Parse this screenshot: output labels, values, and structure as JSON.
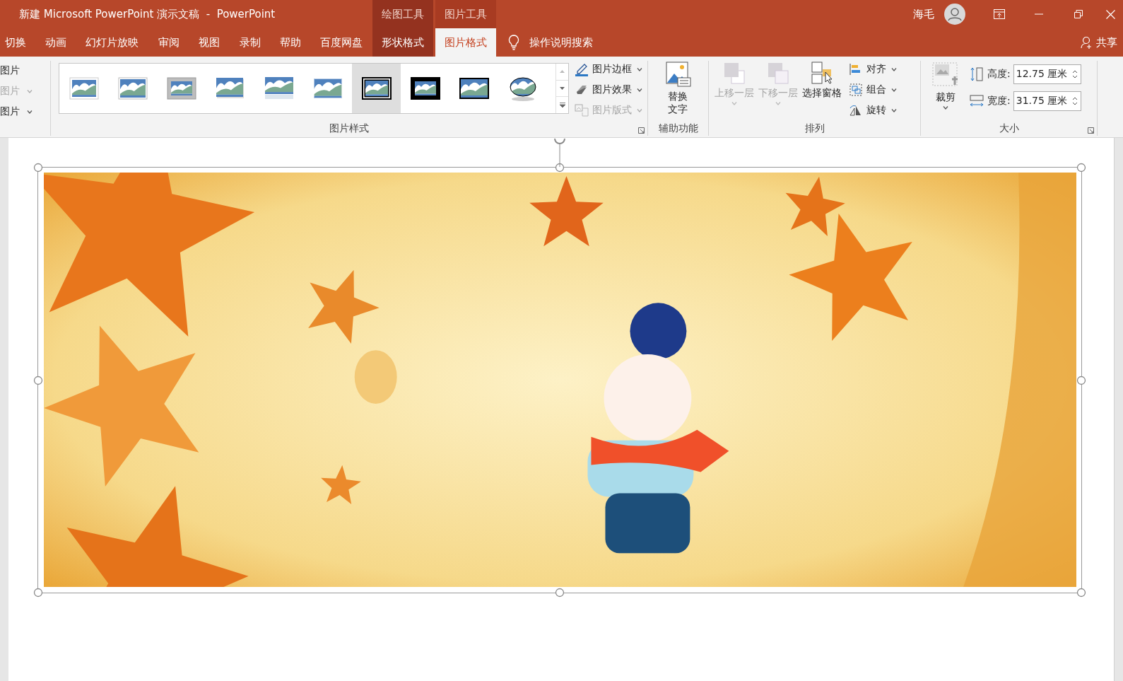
{
  "window": {
    "title": "新建 Microsoft PowerPoint 演示文稿  -  PowerPoint",
    "user": "海毛"
  },
  "context_tools": [
    {
      "label": "绘图工具",
      "active": false
    },
    {
      "label": "图片工具",
      "active": true
    }
  ],
  "tabs": [
    {
      "label": "切换",
      "kind": "main",
      "selected": false
    },
    {
      "label": "动画",
      "kind": "main",
      "selected": false
    },
    {
      "label": "幻灯片放映",
      "kind": "main",
      "selected": false
    },
    {
      "label": "审阅",
      "kind": "main",
      "selected": false
    },
    {
      "label": "视图",
      "kind": "main",
      "selected": false
    },
    {
      "label": "录制",
      "kind": "main",
      "selected": false
    },
    {
      "label": "帮助",
      "kind": "main",
      "selected": false
    },
    {
      "label": "百度网盘",
      "kind": "main",
      "selected": false
    },
    {
      "label": "形状格式",
      "kind": "context",
      "selected": false
    },
    {
      "label": "图片格式",
      "kind": "context",
      "selected": true
    }
  ],
  "tell_me": "操作说明搜索",
  "share": "共享",
  "ribbon": {
    "adjust": [
      {
        "label": "图片",
        "disabled": false,
        "dropdown": false
      },
      {
        "label": "图片",
        "disabled": true,
        "dropdown": true
      },
      {
        "label": "图片",
        "disabled": false,
        "dropdown": true
      }
    ],
    "picture_styles": {
      "title": "图片样式",
      "presets": [
        {
          "selected": false
        },
        {
          "selected": false
        },
        {
          "selected": false
        },
        {
          "selected": false
        },
        {
          "selected": false
        },
        {
          "selected": false
        },
        {
          "selected": true
        },
        {
          "selected": false
        },
        {
          "selected": false
        },
        {
          "selected": false
        }
      ],
      "commands": [
        {
          "label": "图片边框",
          "disabled": false
        },
        {
          "label": "图片效果",
          "disabled": false
        },
        {
          "label": "图片版式",
          "disabled": true
        }
      ]
    },
    "accessibility": {
      "title": "辅助功能",
      "button": "替换文字"
    },
    "arrange": {
      "title": "排列",
      "buttons": [
        {
          "label": "上移一层",
          "disabled": true,
          "dropdown": true
        },
        {
          "label": "下移一层",
          "disabled": true,
          "dropdown": true
        },
        {
          "label": "选择窗格",
          "disabled": false,
          "dropdown": false
        }
      ],
      "commands": [
        {
          "label": "对齐"
        },
        {
          "label": "组合"
        },
        {
          "label": "旋转"
        }
      ]
    },
    "size": {
      "title": "大小",
      "crop": "裁剪",
      "fields": [
        {
          "label": "高度:",
          "value": "12.75 厘米"
        },
        {
          "label": "宽度:",
          "value": "31.75 厘米"
        }
      ]
    }
  },
  "slide": {
    "image": {
      "kind": "picture",
      "selected": true
    }
  }
}
